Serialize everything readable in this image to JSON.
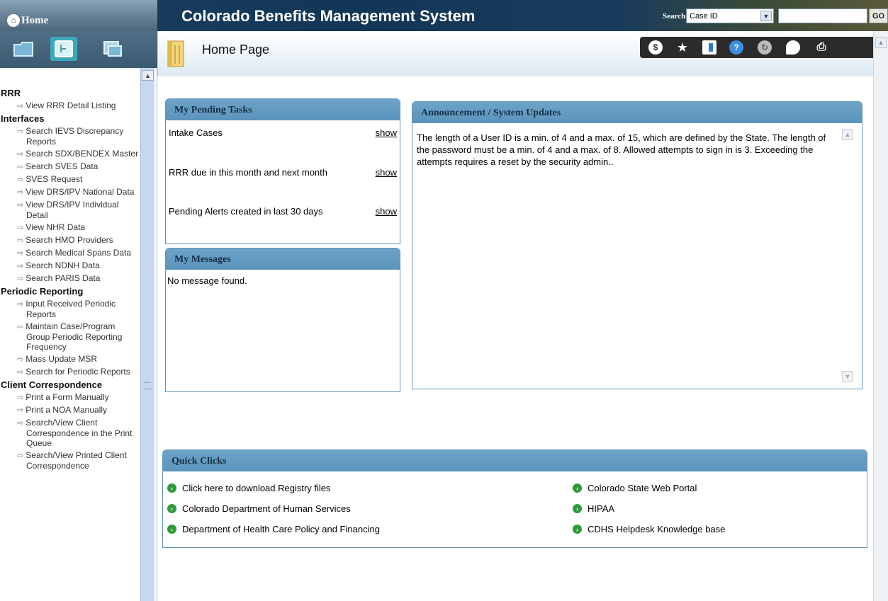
{
  "header": {
    "home_label": "Home",
    "app_title": "Colorado Benefits Management System",
    "search_label": "Search",
    "search_type_value": "Case ID",
    "search_value": "",
    "go_label": "GO"
  },
  "page": {
    "title": "Home Page"
  },
  "sidebar": {
    "groups": [
      {
        "label": "RRR",
        "items": [
          "View RRR Detail Listing"
        ]
      },
      {
        "label": "Interfaces",
        "items": [
          "Search IEVS Discrepancy Reports",
          "Search SDX/BENDEX Master",
          "Search SVES Data",
          "SVES Request",
          "View DRS/IPV National Data",
          "View DRS/IPV Individual Detail",
          "View NHR Data",
          "Search HMO Providers",
          "Search Medical Spans Data",
          "Search NDNH Data",
          "Search PARIS Data"
        ]
      },
      {
        "label": "Periodic Reporting",
        "items": [
          "Input Received Periodic Reports",
          "Maintain Case/Program Group Periodic Reporting Frequency",
          "Mass Update MSR",
          "Search for Periodic Reports"
        ]
      },
      {
        "label": "Client Correspondence",
        "items": [
          "Print a Form Manually",
          "Print a NOA Manually",
          "Search/View Client Correspondence in the Print Queue",
          "Search/View Printed Client Correspondence"
        ]
      }
    ]
  },
  "pending_tasks": {
    "title": "My Pending Tasks",
    "rows": [
      {
        "label": "Intake Cases",
        "action": "show"
      },
      {
        "label": "RRR due in this month and next month",
        "action": "show"
      },
      {
        "label": "Pending Alerts created in last 30 days",
        "action": "show"
      }
    ]
  },
  "messages": {
    "title": "My Messages",
    "empty_text": "No message found."
  },
  "announcement": {
    "title": "Announcement / System Updates",
    "text": "The length of a User ID is a min. of 4 and a max. of 15, which are defined by the State.  The length of the password must be a min. of 4 and a max. of 8.  Allowed attempts to sign in is 3. Exceeding the attempts requires a reset by the security admin.."
  },
  "quick_clicks": {
    "title": "Quick Clicks",
    "left": [
      "Click here to download Registry files",
      "Colorado Department of Human Services",
      "Department of Health Care Policy and Financing"
    ],
    "right": [
      "Colorado State Web Portal",
      "HIPAA",
      "CDHS Helpdesk Knowledge base"
    ]
  },
  "colors": {
    "panel_header": "#5b94bc",
    "header_bg": "#123657",
    "link_icon": "#2f9a3a"
  }
}
